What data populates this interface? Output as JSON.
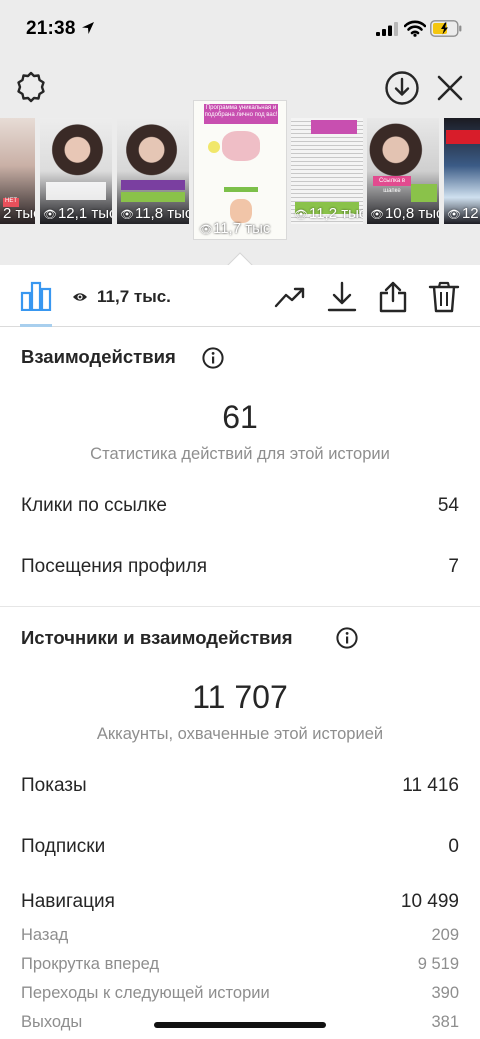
{
  "status_bar": {
    "time": "21:38"
  },
  "stories": [
    {
      "views": "2 тыс"
    },
    {
      "views": "12,1 тыс"
    },
    {
      "views": "11,8 тыс"
    },
    {
      "views": "11,7 тыс"
    },
    {
      "views": "11,2 тыс"
    },
    {
      "views": "10,8 тыс"
    },
    {
      "views": "12"
    }
  ],
  "selected_story_text": {
    "banner": "Программа уникальная и подобрана лично под вас!"
  },
  "thumb_badges": {
    "no_label": "НЕТ",
    "link_label": "Ссылка в шапке"
  },
  "toolbar": {
    "views_label": "11,7 тыс."
  },
  "interactions": {
    "title": "Взаимодействия",
    "total": "61",
    "caption": "Статистика действий для этой истории",
    "rows": [
      {
        "label": "Клики по ссылке",
        "value": "54"
      },
      {
        "label": "Посещения профиля",
        "value": "7"
      }
    ]
  },
  "discovery": {
    "title": "Источники и взаимодействия",
    "total": "11 707",
    "caption": "Аккаунты, охваченные этой историей",
    "rows": [
      {
        "label": "Показы",
        "value": "11 416"
      },
      {
        "label": "Подписки",
        "value": "0"
      },
      {
        "label": "Навигация",
        "value": "10 499"
      }
    ],
    "navigation": [
      {
        "label": "Назад",
        "value": "209"
      },
      {
        "label": "Прокрутка вперед",
        "value": "9 519"
      },
      {
        "label": "Переходы к следующей истории",
        "value": "390"
      },
      {
        "label": "Выходы",
        "value": "381"
      }
    ]
  },
  "colors": {
    "top_background": "#ececec",
    "accent_underline": "#a8cfee",
    "text_primary": "#262626",
    "text_secondary": "#8e8e8e"
  },
  "icons": [
    "location-arrow-icon",
    "signal-icon",
    "wifi-icon",
    "battery-icon",
    "settings-icon",
    "download-circle-icon",
    "close-icon",
    "bar-chart-icon",
    "eye-icon",
    "trend-icon",
    "download-icon",
    "share-icon",
    "trash-icon",
    "info-icon"
  ]
}
